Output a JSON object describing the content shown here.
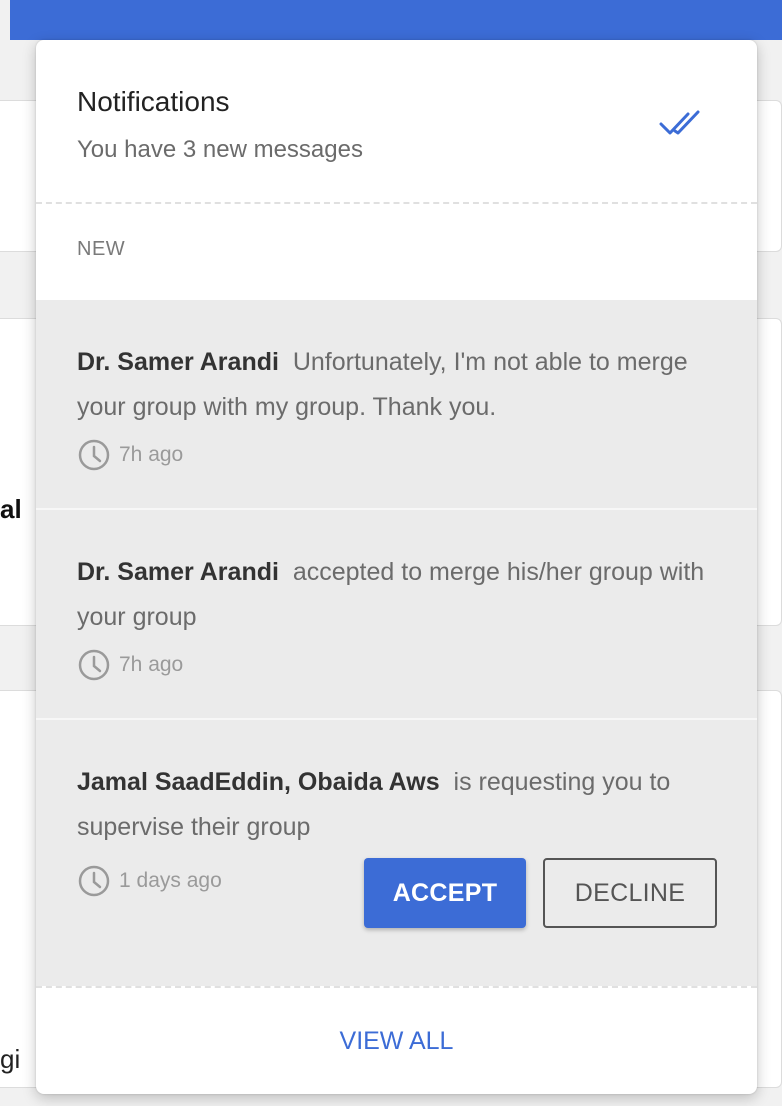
{
  "background": {
    "fragment_1": "al",
    "fragment_2": "gi"
  },
  "notifications_panel": {
    "title": "Notifications",
    "subtitle": "You have 3 new messages",
    "mark_all_read_icon": "double-check-icon",
    "section_label": "NEW",
    "items": [
      {
        "sender": "Dr. Samer Arandi",
        "message": "Unfortunately, I'm not able to merge your group with my group. Thank you.",
        "time": "7h ago"
      },
      {
        "sender": "Dr. Samer Arandi",
        "message": "accepted to merge his/her group with your group",
        "time": "7h ago"
      },
      {
        "sender": "Jamal SaadEddin, Obaida Aws",
        "message": "is requesting you to supervise their group",
        "time": "1 days ago",
        "accept_label": "ACCEPT",
        "decline_label": "DECLINE"
      }
    ],
    "view_all_label": "VIEW ALL"
  },
  "colors": {
    "primary": "#3c6cd6",
    "item_background": "#ebebeb",
    "muted_text": "#6b6b6b"
  }
}
